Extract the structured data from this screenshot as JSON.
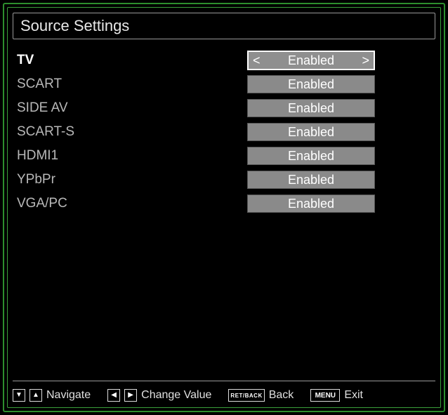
{
  "title": "Source Settings",
  "sources": [
    {
      "name": "TV",
      "value": "Enabled",
      "selected": true
    },
    {
      "name": "SCART",
      "value": "Enabled",
      "selected": false
    },
    {
      "name": "SIDE AV",
      "value": "Enabled",
      "selected": false
    },
    {
      "name": "SCART-S",
      "value": "Enabled",
      "selected": false
    },
    {
      "name": "HDMI1",
      "value": "Enabled",
      "selected": false
    },
    {
      "name": "YPbPr",
      "value": "Enabled",
      "selected": false
    },
    {
      "name": "VGA/PC",
      "value": "Enabled",
      "selected": false
    }
  ],
  "footer": {
    "navigate": "Navigate",
    "change_value": "Change Value",
    "back": "Back",
    "back_key": "RET/BACK",
    "exit": "Exit",
    "exit_key": "MENU"
  }
}
